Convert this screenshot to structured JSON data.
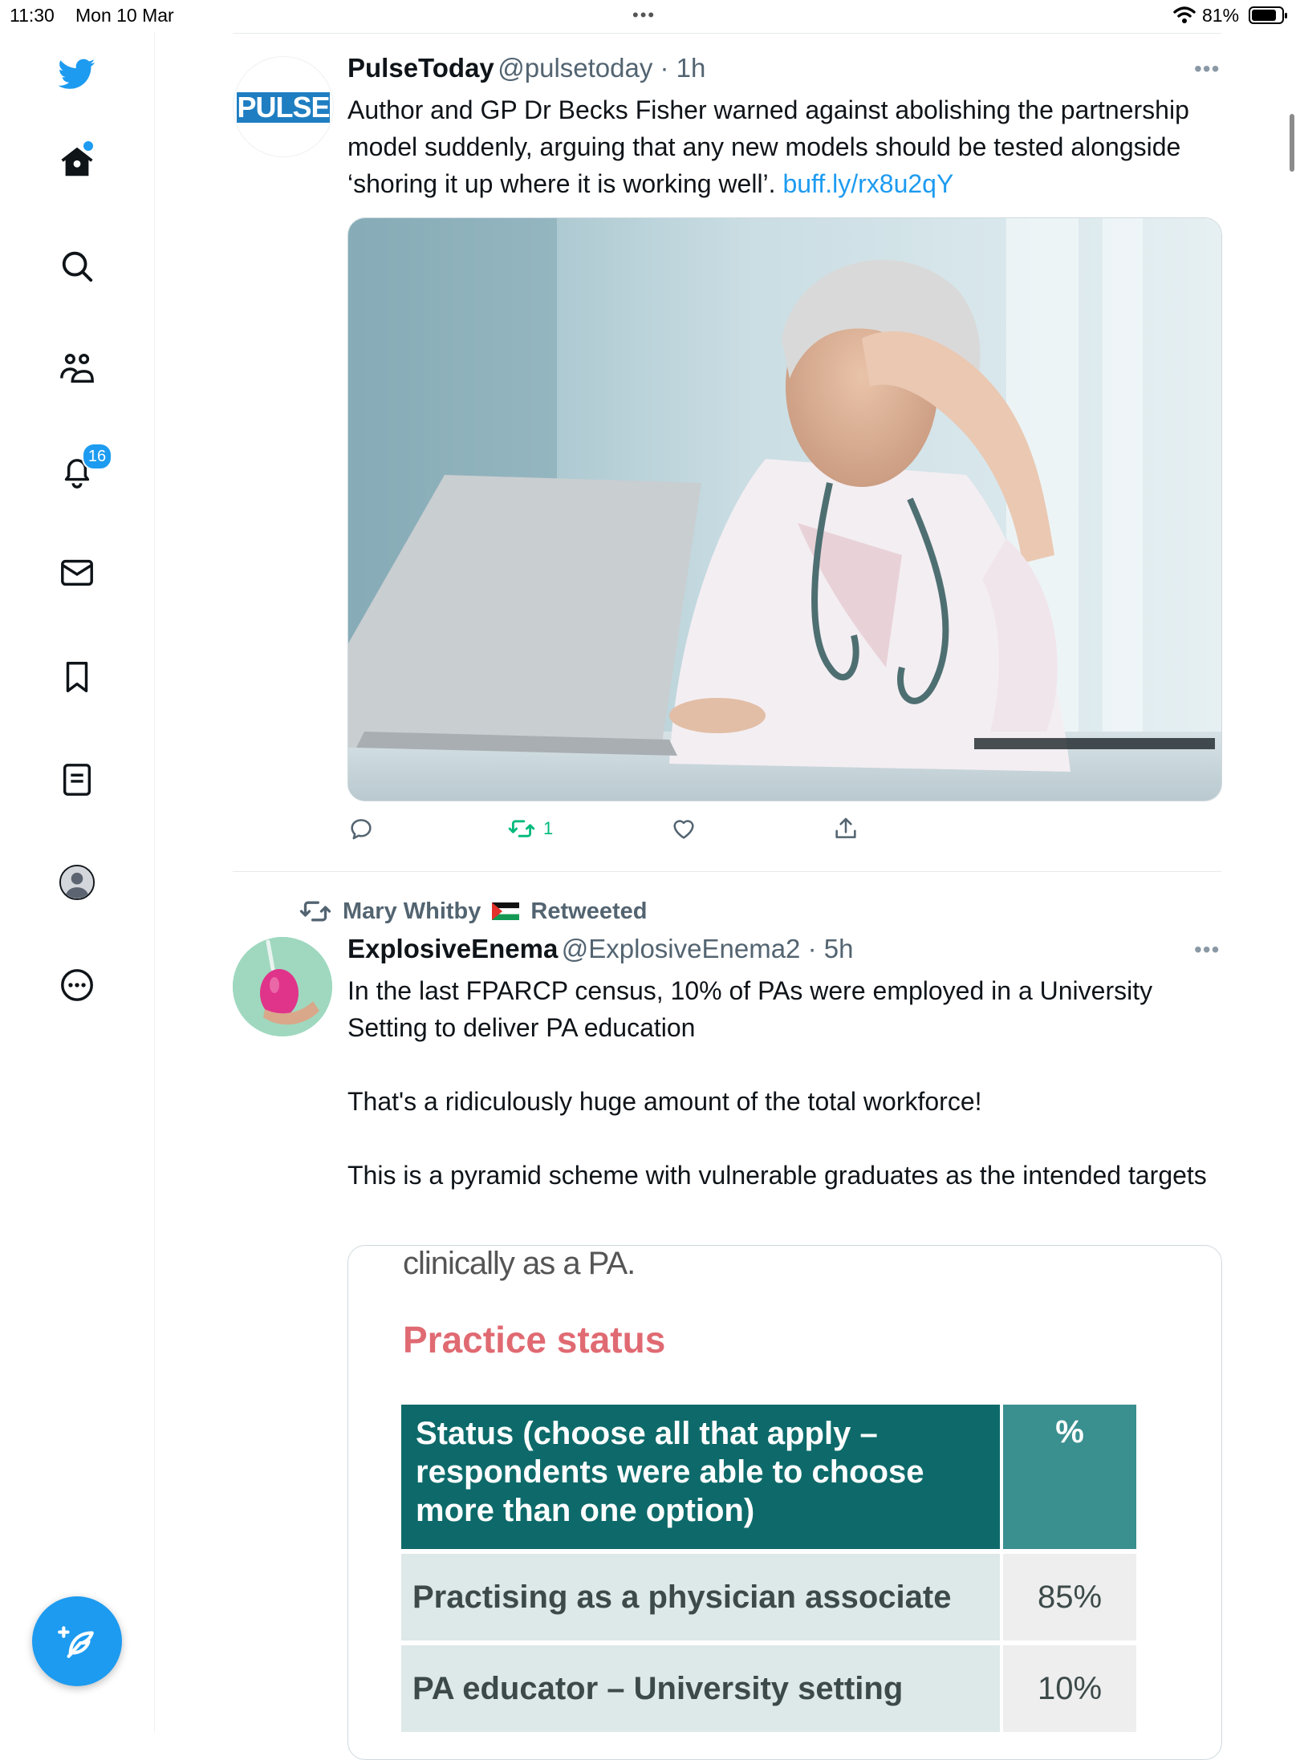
{
  "status_bar": {
    "time": "11:30",
    "date": "Mon 10 Mar",
    "battery": "81%"
  },
  "sidebar": {
    "notifications_count": "16"
  },
  "tweet1": {
    "display_name": "PulseToday",
    "handle_time": "@pulsetoday · 1h",
    "avatar_text": "PULSE",
    "text": "Author and GP Dr Becks Fisher warned against abolishing the partnership model suddenly, arguing that any new models should be tested alongside ‘shoring it up where it is working well’.",
    "link": "buff.ly/rx8u2qY",
    "retweet_count": "1"
  },
  "tweet2": {
    "retweeted_by": "Mary Whitby",
    "retweeted_label": "Retweeted",
    "display_name": "ExplosiveEnema",
    "handle_time": "@ExplosiveEnema2 · 5h",
    "paragraphs": [
      "In the last FPARCP census, 10% of PAs were employed in a University Setting to deliver PA education",
      "That's a ridiculously huge amount of the total workforce!",
      "This is a pyramid scheme with vulnerable graduates as the intended targets"
    ],
    "image": {
      "top_text": "clinically as a PA.",
      "heading": "Practice status",
      "table": {
        "col1": "Status (choose all that apply – respondents were able to choose more than one option)",
        "col2": "%",
        "rows": [
          {
            "status": "Practising as a physician associate",
            "pct": "85%"
          },
          {
            "status": "PA educator – University setting",
            "pct": "10%"
          }
        ]
      }
    }
  },
  "colors": {
    "accent": "#1d9bf0",
    "retweet_green": "#00ba7c",
    "table_header": "#0e6a6a",
    "heading_red": "#e06a72"
  }
}
